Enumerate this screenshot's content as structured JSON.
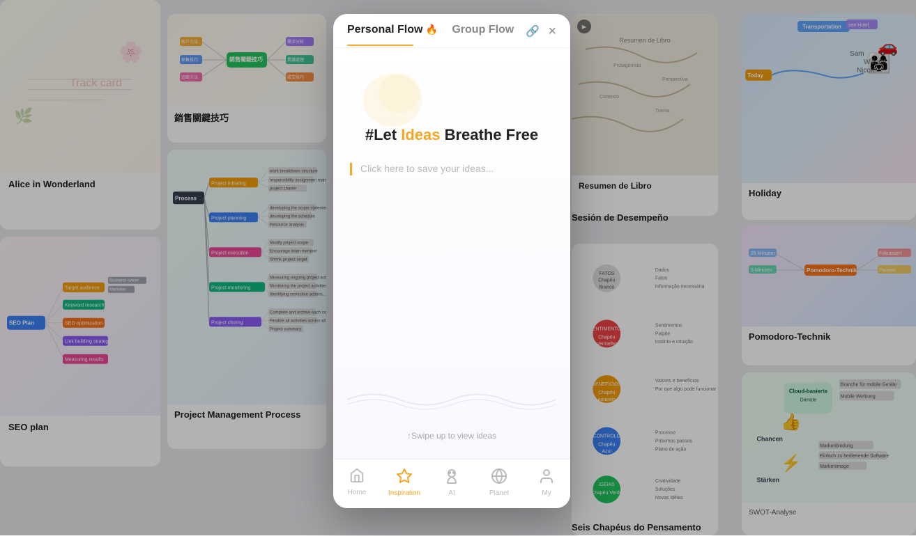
{
  "modal": {
    "tabs": [
      {
        "label": "Personal Flow",
        "active": true
      },
      {
        "label": "Group Flow",
        "active": false
      }
    ],
    "headline": "#Let Ideas Breathe Free",
    "headline_highlight": "Ideas",
    "input_placeholder": "Click here to save your ideas...",
    "swipe_hint": "↑Swipe up to view ideas",
    "link_icon": "🔗"
  },
  "nav": [
    {
      "label": "Home",
      "icon": "⌂",
      "active": false
    },
    {
      "label": "Inspiration",
      "icon": "◈",
      "active": true
    },
    {
      "label": "AI",
      "icon": "👾",
      "active": false
    },
    {
      "label": "Planet",
      "icon": "◉",
      "active": false
    },
    {
      "label": "My",
      "icon": "○",
      "active": false
    }
  ],
  "cards": {
    "sales": {
      "title": "銷售關鍵技巧"
    },
    "alice": {
      "title": "Alice in Wonderland"
    },
    "project": {
      "title": "Project Management Process"
    },
    "seo": {
      "title": "SEO plan"
    },
    "holiday": {
      "title": "Holiday"
    },
    "pomodoro": {
      "title": "Pomodoro-Technik"
    },
    "libro": {
      "title": "Resumen de Libro"
    },
    "desempeno": {
      "title": "Sesión de Desempeño"
    },
    "chapeus": {
      "title": "Seis Chapéus do Pensamento"
    },
    "swot": {
      "title": "SWOT-Analyse"
    }
  },
  "colors": {
    "accent": "#f5a623",
    "active_nav": "#f5a623",
    "inactive": "#bbbbbb",
    "headline_normal": "#222222",
    "headline_highlight": "#f5a623"
  }
}
